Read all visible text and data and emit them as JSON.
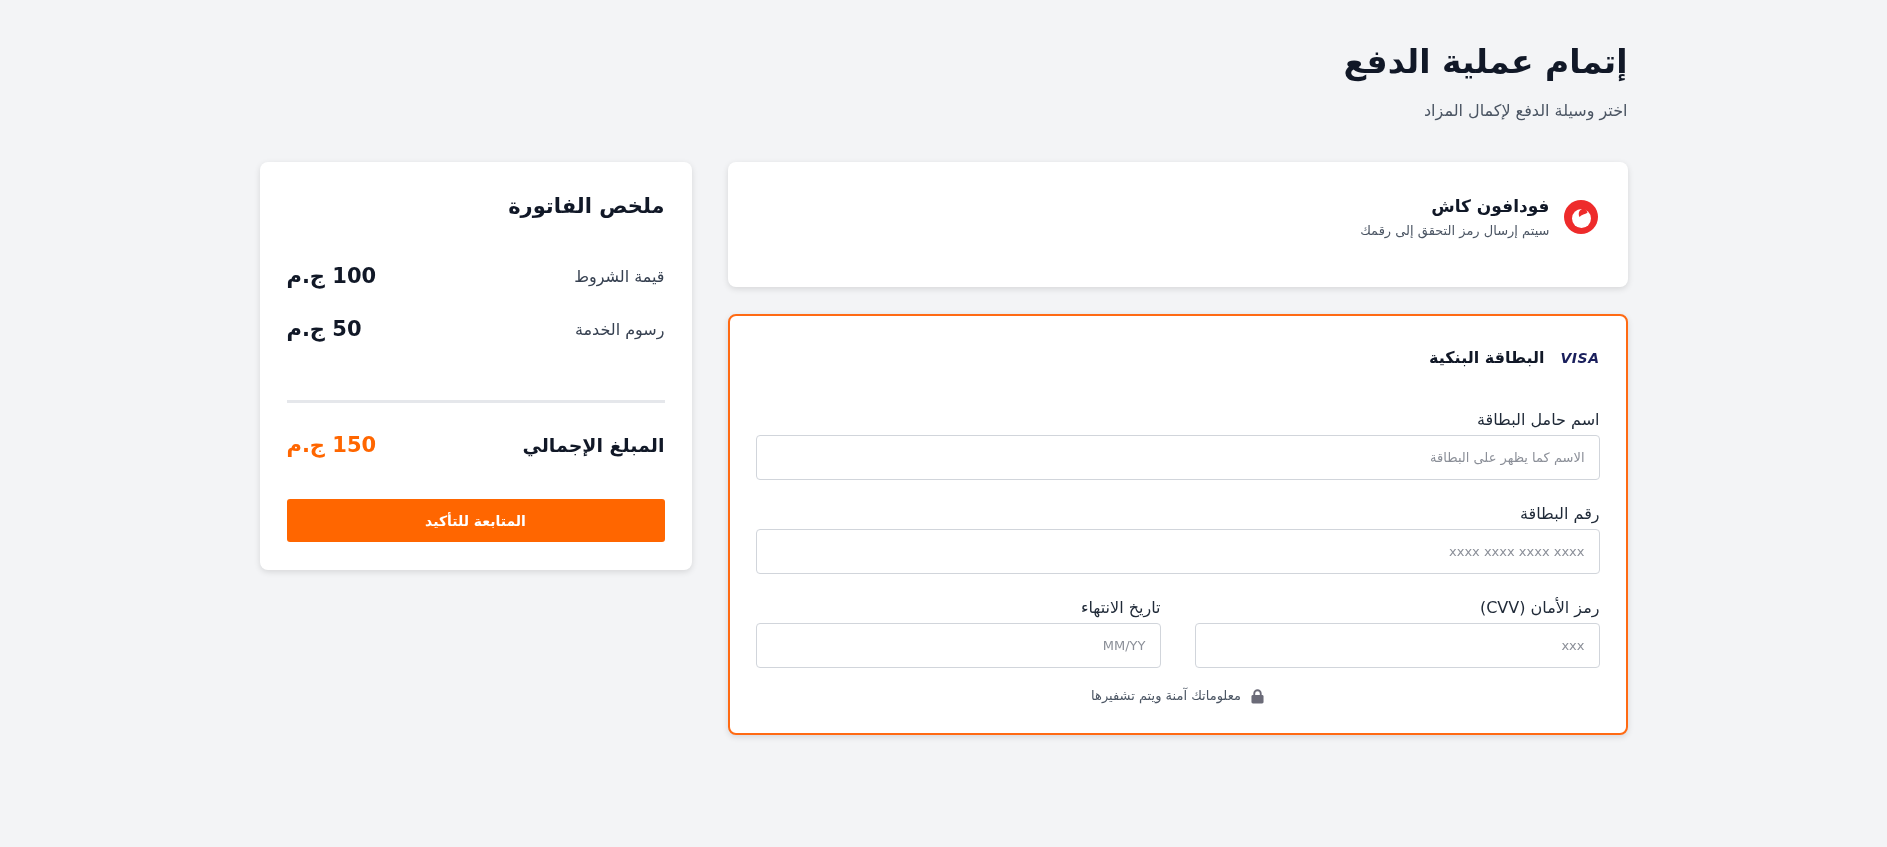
{
  "page": {
    "title": "إتمام عملية الدفع",
    "subtitle": "اختر وسيلة الدفع لإكمال المزاد"
  },
  "payment_methods": [
    {
      "kind": "wallet",
      "title": "فودافون كاش",
      "subtitle": "سيتم إرسال رمز التحقق إلى رقمك",
      "selected": false
    },
    {
      "kind": "card",
      "title": "البطاقة البنكية",
      "brand": "VISA",
      "selected": true,
      "field_rows": [
        [
          {
            "label": "اسم حامل البطاقة",
            "placeholder": "الاسم كما يظهر على البطاقة"
          }
        ],
        [
          {
            "label": "رقم البطاقة",
            "placeholder": "xxxx xxxx xxxx xxxx"
          }
        ],
        [
          {
            "label": "رمز الأمان (CVV)",
            "placeholder": "xxx"
          },
          {
            "label": "تاريخ الانتهاء",
            "placeholder": "MM/YY"
          }
        ]
      ],
      "security_note": "معلوماتك آمنة ويتم تشفيرها"
    }
  ],
  "summary": {
    "title": "ملخص الفاتورة",
    "lines": [
      {
        "label": "قيمة الشروط",
        "amount": "100 ج.م"
      },
      {
        "label": "رسوم الخدمة",
        "amount": "50 ج.م"
      }
    ],
    "total": {
      "label": "المبلغ الإجمالي",
      "amount": "150 ج.م"
    },
    "button": "المتابعة للتأكيد"
  }
}
